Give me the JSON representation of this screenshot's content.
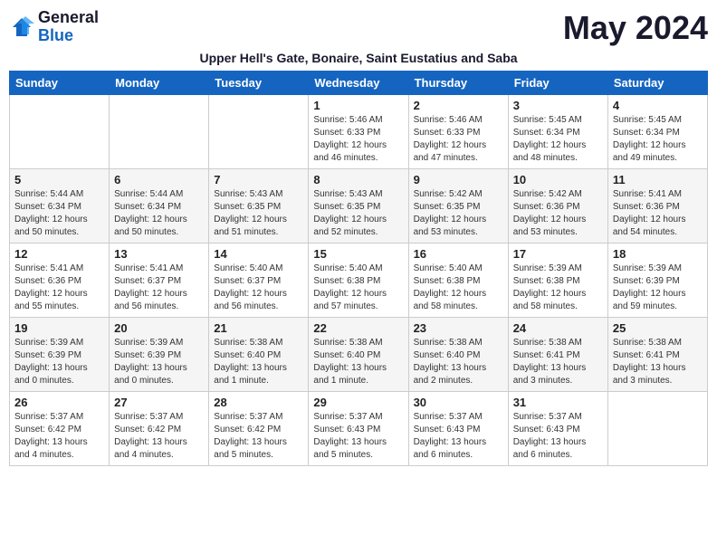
{
  "logo": {
    "line1": "General",
    "line2": "Blue"
  },
  "month": "May 2024",
  "subtitle": "Upper Hell's Gate, Bonaire, Saint Eustatius and Saba",
  "days_of_week": [
    "Sunday",
    "Monday",
    "Tuesday",
    "Wednesday",
    "Thursday",
    "Friday",
    "Saturday"
  ],
  "weeks": [
    [
      {
        "day": "",
        "info": ""
      },
      {
        "day": "",
        "info": ""
      },
      {
        "day": "",
        "info": ""
      },
      {
        "day": "1",
        "info": "Sunrise: 5:46 AM\nSunset: 6:33 PM\nDaylight: 12 hours and 46 minutes."
      },
      {
        "day": "2",
        "info": "Sunrise: 5:46 AM\nSunset: 6:33 PM\nDaylight: 12 hours and 47 minutes."
      },
      {
        "day": "3",
        "info": "Sunrise: 5:45 AM\nSunset: 6:34 PM\nDaylight: 12 hours and 48 minutes."
      },
      {
        "day": "4",
        "info": "Sunrise: 5:45 AM\nSunset: 6:34 PM\nDaylight: 12 hours and 49 minutes."
      }
    ],
    [
      {
        "day": "5",
        "info": "Sunrise: 5:44 AM\nSunset: 6:34 PM\nDaylight: 12 hours and 50 minutes."
      },
      {
        "day": "6",
        "info": "Sunrise: 5:44 AM\nSunset: 6:34 PM\nDaylight: 12 hours and 50 minutes."
      },
      {
        "day": "7",
        "info": "Sunrise: 5:43 AM\nSunset: 6:35 PM\nDaylight: 12 hours and 51 minutes."
      },
      {
        "day": "8",
        "info": "Sunrise: 5:43 AM\nSunset: 6:35 PM\nDaylight: 12 hours and 52 minutes."
      },
      {
        "day": "9",
        "info": "Sunrise: 5:42 AM\nSunset: 6:35 PM\nDaylight: 12 hours and 53 minutes."
      },
      {
        "day": "10",
        "info": "Sunrise: 5:42 AM\nSunset: 6:36 PM\nDaylight: 12 hours and 53 minutes."
      },
      {
        "day": "11",
        "info": "Sunrise: 5:41 AM\nSunset: 6:36 PM\nDaylight: 12 hours and 54 minutes."
      }
    ],
    [
      {
        "day": "12",
        "info": "Sunrise: 5:41 AM\nSunset: 6:36 PM\nDaylight: 12 hours and 55 minutes."
      },
      {
        "day": "13",
        "info": "Sunrise: 5:41 AM\nSunset: 6:37 PM\nDaylight: 12 hours and 56 minutes."
      },
      {
        "day": "14",
        "info": "Sunrise: 5:40 AM\nSunset: 6:37 PM\nDaylight: 12 hours and 56 minutes."
      },
      {
        "day": "15",
        "info": "Sunrise: 5:40 AM\nSunset: 6:38 PM\nDaylight: 12 hours and 57 minutes."
      },
      {
        "day": "16",
        "info": "Sunrise: 5:40 AM\nSunset: 6:38 PM\nDaylight: 12 hours and 58 minutes."
      },
      {
        "day": "17",
        "info": "Sunrise: 5:39 AM\nSunset: 6:38 PM\nDaylight: 12 hours and 58 minutes."
      },
      {
        "day": "18",
        "info": "Sunrise: 5:39 AM\nSunset: 6:39 PM\nDaylight: 12 hours and 59 minutes."
      }
    ],
    [
      {
        "day": "19",
        "info": "Sunrise: 5:39 AM\nSunset: 6:39 PM\nDaylight: 13 hours and 0 minutes."
      },
      {
        "day": "20",
        "info": "Sunrise: 5:39 AM\nSunset: 6:39 PM\nDaylight: 13 hours and 0 minutes."
      },
      {
        "day": "21",
        "info": "Sunrise: 5:38 AM\nSunset: 6:40 PM\nDaylight: 13 hours and 1 minute."
      },
      {
        "day": "22",
        "info": "Sunrise: 5:38 AM\nSunset: 6:40 PM\nDaylight: 13 hours and 1 minute."
      },
      {
        "day": "23",
        "info": "Sunrise: 5:38 AM\nSunset: 6:40 PM\nDaylight: 13 hours and 2 minutes."
      },
      {
        "day": "24",
        "info": "Sunrise: 5:38 AM\nSunset: 6:41 PM\nDaylight: 13 hours and 3 minutes."
      },
      {
        "day": "25",
        "info": "Sunrise: 5:38 AM\nSunset: 6:41 PM\nDaylight: 13 hours and 3 minutes."
      }
    ],
    [
      {
        "day": "26",
        "info": "Sunrise: 5:37 AM\nSunset: 6:42 PM\nDaylight: 13 hours and 4 minutes."
      },
      {
        "day": "27",
        "info": "Sunrise: 5:37 AM\nSunset: 6:42 PM\nDaylight: 13 hours and 4 minutes."
      },
      {
        "day": "28",
        "info": "Sunrise: 5:37 AM\nSunset: 6:42 PM\nDaylight: 13 hours and 5 minutes."
      },
      {
        "day": "29",
        "info": "Sunrise: 5:37 AM\nSunset: 6:43 PM\nDaylight: 13 hours and 5 minutes."
      },
      {
        "day": "30",
        "info": "Sunrise: 5:37 AM\nSunset: 6:43 PM\nDaylight: 13 hours and 6 minutes."
      },
      {
        "day": "31",
        "info": "Sunrise: 5:37 AM\nSunset: 6:43 PM\nDaylight: 13 hours and 6 minutes."
      },
      {
        "day": "",
        "info": ""
      }
    ]
  ]
}
